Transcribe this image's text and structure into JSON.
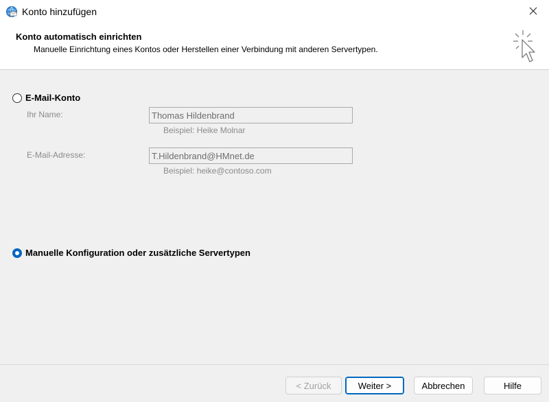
{
  "window": {
    "title": "Konto hinzufügen",
    "icon": "globe-mail-icon"
  },
  "header": {
    "title": "Konto automatisch einrichten",
    "subtitle": "Manuelle Einrichtung eines Kontos oder Herstellen einer Verbindung mit anderen Servertypen.",
    "icon": "cursor-click-icon"
  },
  "options": {
    "email_account": {
      "label": "E-Mail-Konto",
      "selected": false,
      "name_label": "Ihr Name:",
      "name_value": "Thomas Hildenbrand",
      "name_hint": "Beispiel: Heike Molnar",
      "email_label": "E-Mail-Adresse:",
      "email_value": "T.Hildenbrand@HMnet.de",
      "email_hint": "Beispiel: heike@contoso.com"
    },
    "manual": {
      "label": "Manuelle Konfiguration oder zusätzliche Servertypen",
      "selected": true
    }
  },
  "buttons": {
    "back": "< Zurück",
    "next": "Weiter >",
    "cancel": "Abbrechen",
    "help": "Hilfe"
  },
  "colors": {
    "accent": "#0067c0",
    "disabled_text": "#8a8a8a"
  }
}
